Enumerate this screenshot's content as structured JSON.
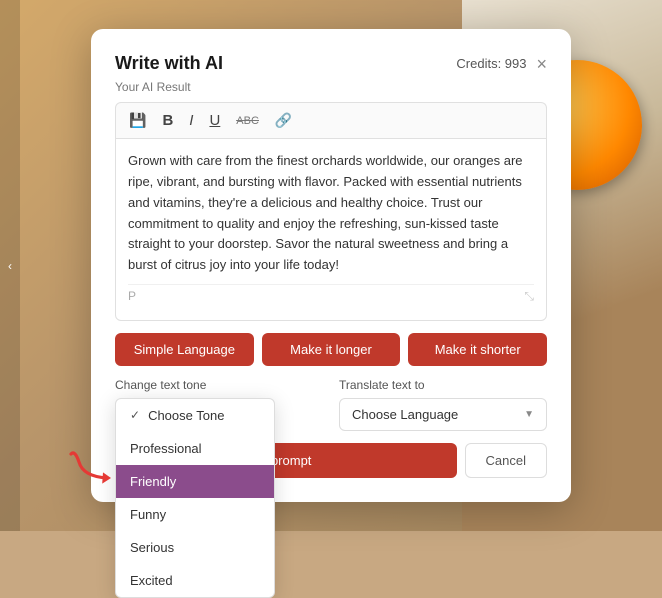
{
  "modal": {
    "title": "Write with AI",
    "credits_label": "Credits: 993",
    "close_label": "×",
    "result_label": "Your AI Result",
    "ai_text": "Grown with care from the finest orchards worldwide, our oranges are ripe, vibrant, and bursting with flavor. Packed with essential nutrients and vitamins, they're a delicious and healthy choice. Trust our commitment to quality and enjoy the refreshing, sun-kissed taste straight to your doorstep. Savor the natural sweetness and bring a burst of citrus joy into your life today!",
    "footer_char": "P",
    "toolbar": {
      "save_icon": "💾",
      "bold_icon": "B",
      "italic_icon": "I",
      "underline_icon": "U",
      "strikethrough_icon": "ABC",
      "link_icon": "🔗"
    },
    "action_buttons": [
      {
        "id": "simple",
        "label": "Simple Language"
      },
      {
        "id": "longer",
        "label": "Make it longer"
      },
      {
        "id": "shorter",
        "label": "Make it shorter"
      }
    ],
    "tone_section": {
      "label": "Change text tone",
      "options": [
        {
          "id": "choose",
          "label": "Choose Tone",
          "checked": true,
          "selected": false
        },
        {
          "id": "professional",
          "label": "Professional",
          "checked": false,
          "selected": false
        },
        {
          "id": "friendly",
          "label": "Friendly",
          "checked": false,
          "selected": true
        },
        {
          "id": "funny",
          "label": "Funny",
          "checked": false,
          "selected": false
        },
        {
          "id": "serious",
          "label": "Serious",
          "checked": false,
          "selected": false
        },
        {
          "id": "excited",
          "label": "Excited",
          "checked": false,
          "selected": false
        }
      ]
    },
    "translate_section": {
      "label": "Translate text to",
      "placeholder": "Choose Language",
      "dropdown_arrow": "▼"
    },
    "bottom_buttons": {
      "prompt_label": "...prompt",
      "cancel_label": "Cancel"
    }
  }
}
